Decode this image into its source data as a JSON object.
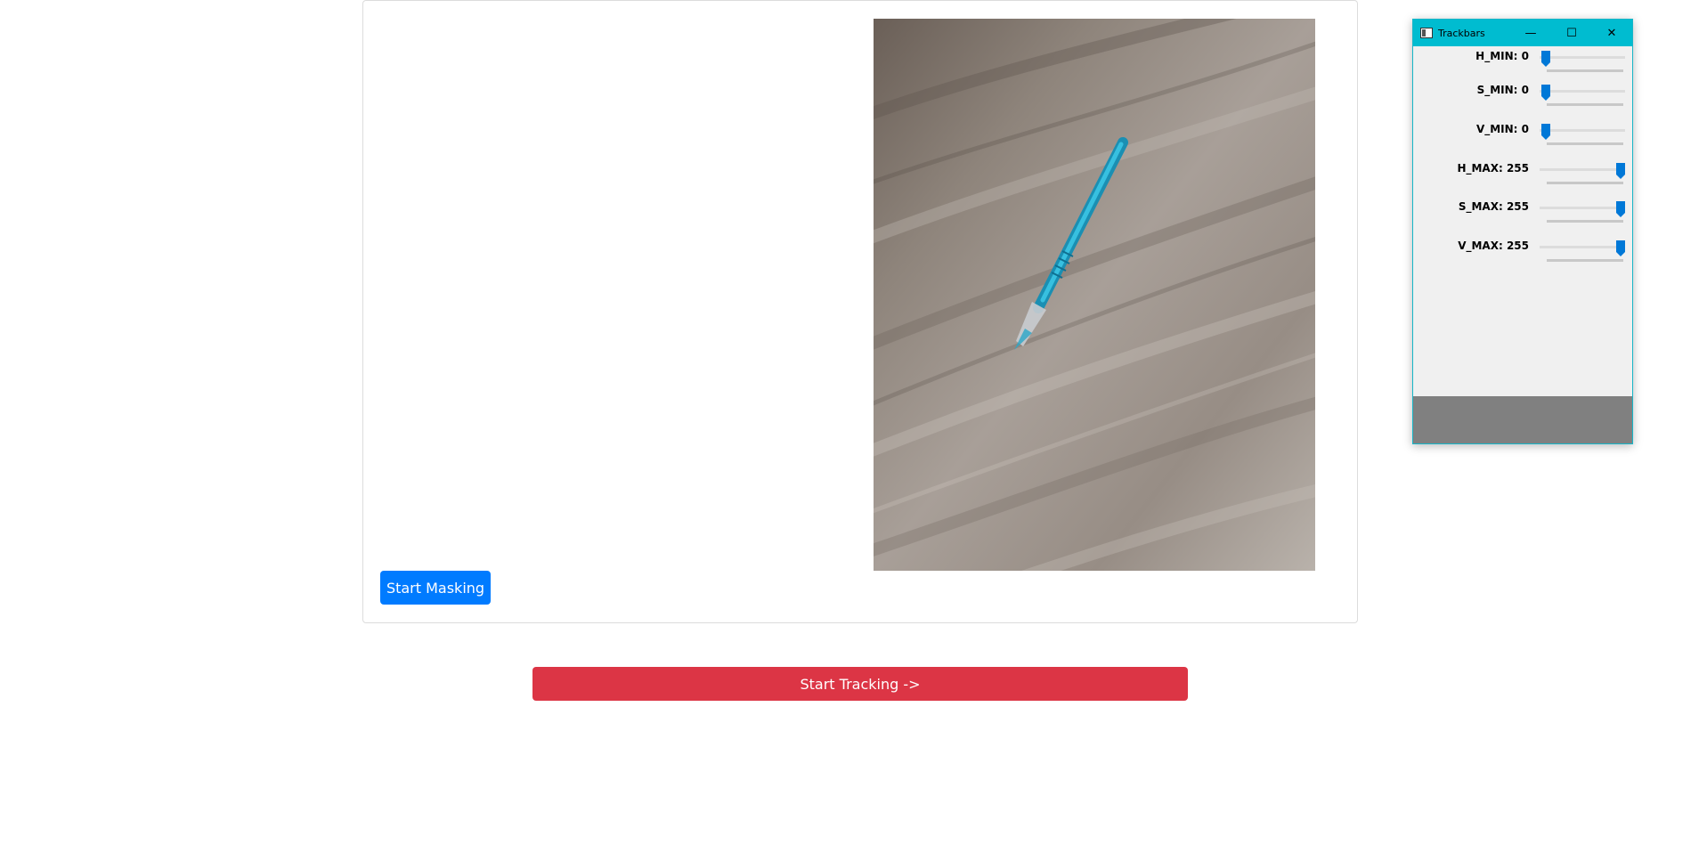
{
  "main": {
    "start_masking_label": "Start Masking",
    "start_tracking_label": "Start Tracking ->"
  },
  "trackbars_window": {
    "title": "Trackbars",
    "minimize_glyph": "—",
    "maximize_glyph": "☐",
    "close_glyph": "✕",
    "sliders": [
      {
        "label": "H_MIN: 0",
        "value": 0,
        "max": 255
      },
      {
        "label": "S_MIN: 0",
        "value": 0,
        "max": 255
      },
      {
        "label": "V_MIN: 0",
        "value": 0,
        "max": 255
      },
      {
        "label": "H_MAX: 255",
        "value": 255,
        "max": 255
      },
      {
        "label": "S_MAX: 255",
        "value": 255,
        "max": 255
      },
      {
        "label": "V_MAX: 255",
        "value": 255,
        "max": 255
      }
    ]
  },
  "colors": {
    "primary_button": "#007bff",
    "danger_button": "#dc3545",
    "titlebar": "#00bcd0",
    "slider_thumb": "#0078d7"
  }
}
